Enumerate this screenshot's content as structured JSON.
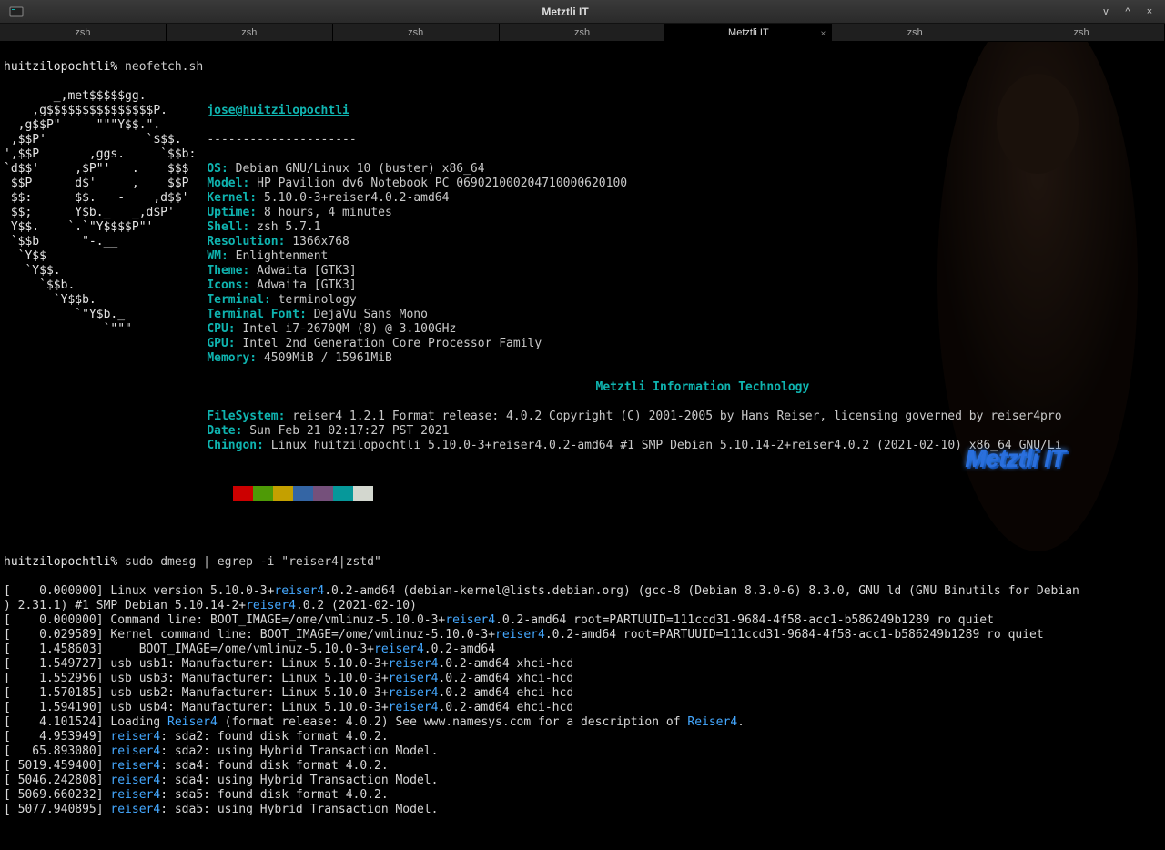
{
  "window": {
    "title": "Metztli IT",
    "btn_min": "v",
    "btn_max": "^",
    "btn_close": "×"
  },
  "tabs": [
    {
      "label": "zsh"
    },
    {
      "label": "zsh"
    },
    {
      "label": "zsh"
    },
    {
      "label": "zsh"
    },
    {
      "label": "Metztli IT",
      "active": true
    },
    {
      "label": "zsh"
    },
    {
      "label": "zsh"
    }
  ],
  "prompt1": {
    "host": "huitzilopochtli%",
    "cmd": " neofetch.sh"
  },
  "ascii": "       _,met$$$$$gg.\n    ,g$$$$$$$$$$$$$$$P.\n  ,g$$P\"     \"\"\"Y$$.\".\n ,$$P'              `$$$.\n',$$P       ,ggs.     `$$b:\n`d$$'     ,$P\"'   .    $$$\n $$P      d$'     ,    $$P\n $$:      $$.   -    ,d$$'\n $$;      Y$b._   _,d$P'\n Y$$.    `.`\"Y$$$$P\"'\n `$$b      \"-.__\n  `Y$$\n   `Y$$.\n     `$$b.\n       `Y$$b.\n          `\"Y$b._\n              `\"\"\"",
  "neofetch": {
    "userhost": "jose@huitzilopochtli",
    "sep": "---------------------",
    "lines": [
      {
        "k": "OS: ",
        "v": "Debian GNU/Linux 10 (buster) x86_64"
      },
      {
        "k": "Model: ",
        "v": "HP Pavilion dv6 Notebook PC 069021000204710000620100"
      },
      {
        "k": "Kernel: ",
        "v": "5.10.0-3+reiser4.0.2-amd64"
      },
      {
        "k": "Uptime: ",
        "v": "8 hours, 4 minutes"
      },
      {
        "k": "Shell: ",
        "v": "zsh 5.7.1"
      },
      {
        "k": "Resolution: ",
        "v": "1366x768"
      },
      {
        "k": "WM: ",
        "v": "Enlightenment"
      },
      {
        "k": "Theme: ",
        "v": "Adwaita [GTK3]"
      },
      {
        "k": "Icons: ",
        "v": "Adwaita [GTK3]"
      },
      {
        "k": "Terminal: ",
        "v": "terminology"
      },
      {
        "k": "Terminal Font: ",
        "v": "DejaVu Sans Mono"
      },
      {
        "k": "CPU: ",
        "v": "Intel i7-2670QM (8) @ 3.100GHz"
      },
      {
        "k": "GPU: ",
        "v": "Intel 2nd Generation Core Processor Family"
      },
      {
        "k": "Memory: ",
        "v": "4509MiB / 15961MiB"
      }
    ],
    "brand": "Metztli Information Technology",
    "extra": [
      {
        "k": "FileSystem: ",
        "v": "reiser4 1.2.1 Format release: 4.0.2 Copyright (C) 2001-2005 by Hans Reiser, licensing governed by reiser4pro"
      },
      {
        "k": "Date: ",
        "v": "Sun Feb 21 02:17:27 PST 2021"
      },
      {
        "k": "Chingon: ",
        "v": "Linux huitzilopochtli 5.10.0-3+reiser4.0.2-amd64 #1 SMP Debian 5.10.14-2+reiser4.0.2 (2021-02-10) x86_64 GNU/Li"
      }
    ]
  },
  "swatches": [
    "#cc0000",
    "#4e9a06",
    "#c4a000",
    "#3465a4",
    "#75507b",
    "#06989a",
    "#d3d7cf"
  ],
  "prompt2": {
    "host": "huitzilopochtli%",
    "cmd": " sudo dmesg | egrep -i \"reiser4|zstd\""
  },
  "dmesg": [
    {
      "t": "[    0.000000] Linux version 5.10.0-3+",
      "h": "reiser4",
      "r": ".0.2-amd64 (debian-kernel@lists.debian.org) (gcc-8 (Debian 8.3.0-6) 8.3.0, GNU ld (GNU Binutils for Debian"
    },
    {
      "t": ") 2.31.1) #1 SMP Debian 5.10.14-2+",
      "h": "reiser4",
      "r": ".0.2 (2021-02-10)"
    },
    {
      "t": "[    0.000000] Command line: BOOT_IMAGE=/ome/vmlinuz-5.10.0-3+",
      "h": "reiser4",
      "r": ".0.2-amd64 root=PARTUUID=111ccd31-9684-4f58-acc1-b586249b1289 ro quiet"
    },
    {
      "t": "[    0.029589] Kernel command line: BOOT_IMAGE=/ome/vmlinuz-5.10.0-3+",
      "h": "reiser4",
      "r": ".0.2-amd64 root=PARTUUID=111ccd31-9684-4f58-acc1-b586249b1289 ro quiet"
    },
    {
      "t": "[    1.458603]     BOOT_IMAGE=/ome/vmlinuz-5.10.0-3+",
      "h": "reiser4",
      "r": ".0.2-amd64"
    },
    {
      "t": "[    1.549727] usb usb1: Manufacturer: Linux 5.10.0-3+",
      "h": "reiser4",
      "r": ".0.2-amd64 xhci-hcd"
    },
    {
      "t": "[    1.552956] usb usb3: Manufacturer: Linux 5.10.0-3+",
      "h": "reiser4",
      "r": ".0.2-amd64 xhci-hcd"
    },
    {
      "t": "[    1.570185] usb usb2: Manufacturer: Linux 5.10.0-3+",
      "h": "reiser4",
      "r": ".0.2-amd64 ehci-hcd"
    },
    {
      "t": "[    1.594190] usb usb4: Manufacturer: Linux 5.10.0-3+",
      "h": "reiser4",
      "r": ".0.2-amd64 ehci-hcd"
    },
    {
      "t": "[    4.101524] Loading ",
      "h": "Reiser4",
      "r": " (format release: 4.0.2) See www.namesys.com for a description of ",
      "h2": "Reiser4",
      "r2": "."
    },
    {
      "t": "[    4.953949] ",
      "h": "reiser4",
      "r": ": sda2: found disk format 4.0.2."
    },
    {
      "t": "[   65.893080] ",
      "h": "reiser4",
      "r": ": sda2: using Hybrid Transaction Model."
    },
    {
      "t": "[ 5019.459400] ",
      "h": "reiser4",
      "r": ": sda4: found disk format 4.0.2."
    },
    {
      "t": "[ 5046.242808] ",
      "h": "reiser4",
      "r": ": sda4: using Hybrid Transaction Model."
    },
    {
      "t": "[ 5069.660232] ",
      "h": "reiser4",
      "r": ": sda5: found disk format 4.0.2."
    },
    {
      "t": "[ 5077.940895] ",
      "h": "reiser4",
      "r": ": sda5: using Hybrid Transaction Model."
    }
  ],
  "watermark": "Metztli IT"
}
